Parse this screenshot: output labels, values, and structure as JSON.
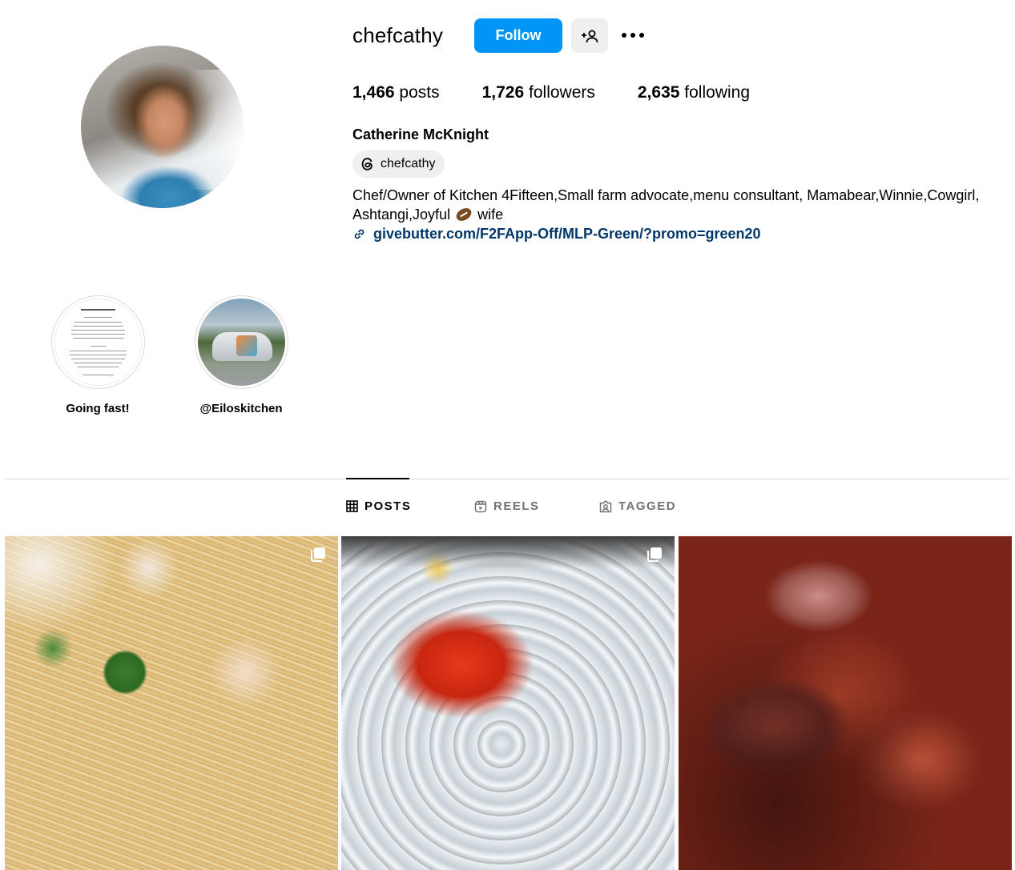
{
  "profile": {
    "username": "chefcathy",
    "follow_label": "Follow",
    "suggest_icon": "person-add-icon",
    "more_icon": "more-horizontal-icon",
    "full_name": "Catherine McKnight",
    "threads_handle": "chefcathy",
    "bio_text": "Chef/Owner of Kitchen 4Fifteen,Small farm advocate,menu consultant, Mamabear,Winnie,Cowgirl, Ashtangi,Joyful",
    "bio_emoji": "american-football-emoji",
    "bio_tail": "wife",
    "link": "givebutter.com/F2FApp-Off/MLP-Green/?promo=green20"
  },
  "stats": [
    {
      "value": "1,466",
      "label": "posts"
    },
    {
      "value": "1,726",
      "label": "followers"
    },
    {
      "value": "2,635",
      "label": "following"
    }
  ],
  "highlights": [
    {
      "label": "Going fast!"
    },
    {
      "label": "@Eiloskitchen"
    }
  ],
  "tabs": [
    {
      "label": "POSTS",
      "icon": "grid-icon",
      "active": true
    },
    {
      "label": "REELS",
      "icon": "reels-icon",
      "active": false
    },
    {
      "label": "TAGGED",
      "icon": "tagged-icon",
      "active": false
    }
  ],
  "posts": [
    {
      "subject": "spaghetti with crab and basil",
      "multi": true
    },
    {
      "subject": "lobster in ice bath",
      "multi": true
    },
    {
      "subject": "braised meat in tomato sauce",
      "multi": false
    }
  ],
  "colors": {
    "follow_blue": "#0095f6",
    "link_blue": "#00376b",
    "muted": "#737373",
    "divider": "#dbdbdb"
  }
}
